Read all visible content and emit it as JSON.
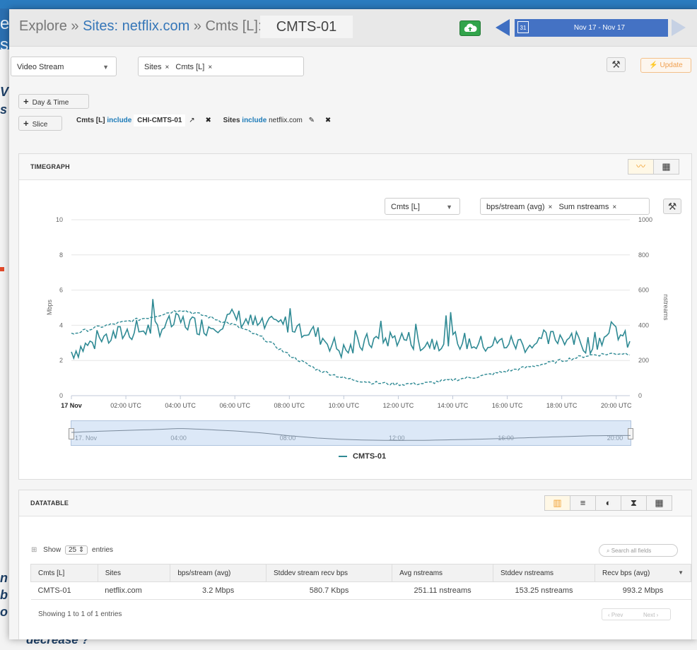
{
  "background": {
    "fragments": [
      "e",
      "s",
      "V",
      "s",
      "n",
      "b",
      "o",
      "decrease ?"
    ]
  },
  "topbar": {
    "crumb_prefix": "Explore »",
    "crumb_sites": "Sites: netflix.com",
    "crumb_sep": "»",
    "crumb_dimension": "Cmts [L]:",
    "crumb_value": "CMTS-01",
    "date_range": "Nov 17 - Nov 17",
    "calendar_day": "31"
  },
  "controls": {
    "metric_select": "Video Stream",
    "dimension_tags": [
      "Sites",
      "Cmts [L]"
    ],
    "update_label": "Update",
    "day_time_label": "Day & Time",
    "slice_label": "Slice"
  },
  "filters": [
    {
      "field": "Cmts [L]",
      "op": "include",
      "value": "CHI-CMTS-01"
    },
    {
      "field": "Sites",
      "op": "include",
      "value": "netflix.com"
    }
  ],
  "timegraph": {
    "title": "TIMEGRAPH",
    "group_select": "Cmts [L]",
    "metric_tags": [
      "bps/stream (avg)",
      "Sum nstreams"
    ],
    "legend_label": "CMTS-01",
    "navigator_labels": [
      "17. Nov",
      "04:00",
      "08:00",
      "12:00",
      "16:00",
      "20:00"
    ]
  },
  "chart_data": {
    "type": "line",
    "ylabel": "Mbps",
    "ylabel_right": "nstreams",
    "ylim": [
      0,
      10
    ],
    "ylim_right": [
      0,
      1000
    ],
    "y_ticks": [
      "0",
      "2",
      "4",
      "6",
      "8",
      "10"
    ],
    "y_ticks_right": [
      "0",
      "200",
      "400",
      "600",
      "800",
      "1000"
    ],
    "x_tick_labels": [
      "17 Nov",
      "02:00 UTC",
      "04:00 UTC",
      "06:00 UTC",
      "08:00 UTC",
      "10:00 UTC",
      "12:00 UTC",
      "14:00 UTC",
      "16:00 UTC",
      "18:00 UTC",
      "20:00 UTC"
    ],
    "x_hours": [
      0,
      1,
      2,
      3,
      4,
      5,
      6,
      7,
      8,
      9,
      10,
      11,
      12,
      13,
      14,
      15,
      16,
      17,
      18,
      19,
      20,
      20.5
    ],
    "series": [
      {
        "name": "CMTS-01",
        "axis": "left",
        "style": "solid",
        "color": "#2f8a94",
        "values": [
          2.5,
          3.1,
          3.6,
          3.8,
          4.2,
          3.9,
          4.5,
          3.9,
          4.1,
          3.5,
          2.5,
          3.1,
          3.3,
          3.0,
          3.2,
          2.9,
          3.0,
          2.9,
          3.4,
          2.9,
          3.7,
          2.9
        ]
      },
      {
        "name": "Sum nstreams",
        "axis": "right",
        "style": "dashed",
        "color": "#2f8a94",
        "values": [
          350,
          390,
          420,
          450,
          490,
          450,
          400,
          330,
          230,
          150,
          100,
          75,
          65,
          70,
          90,
          110,
          140,
          170,
          200,
          230,
          240,
          240
        ]
      }
    ]
  },
  "datatable": {
    "title": "DATATABLE",
    "show_label": "Show",
    "entries_value": "25",
    "entries_label": "entries",
    "search_placeholder": "Search all fields",
    "columns": [
      "Cmts [L]",
      "Sites",
      "bps/stream (avg)",
      "Stddev stream recv bps",
      "Avg nstreams",
      "Stddev nstreams",
      "Recv bps (avg)"
    ],
    "rows": [
      [
        "CMTS-01",
        "netflix.com",
        "3.2 Mbps",
        "580.7 Kbps",
        "251.11 nstreams",
        "153.25 nstreams",
        "993.2 Mbps"
      ]
    ],
    "footer": "Showing 1 to 1 of 1 entries",
    "prev_label": "Prev",
    "next_label": "Next"
  }
}
